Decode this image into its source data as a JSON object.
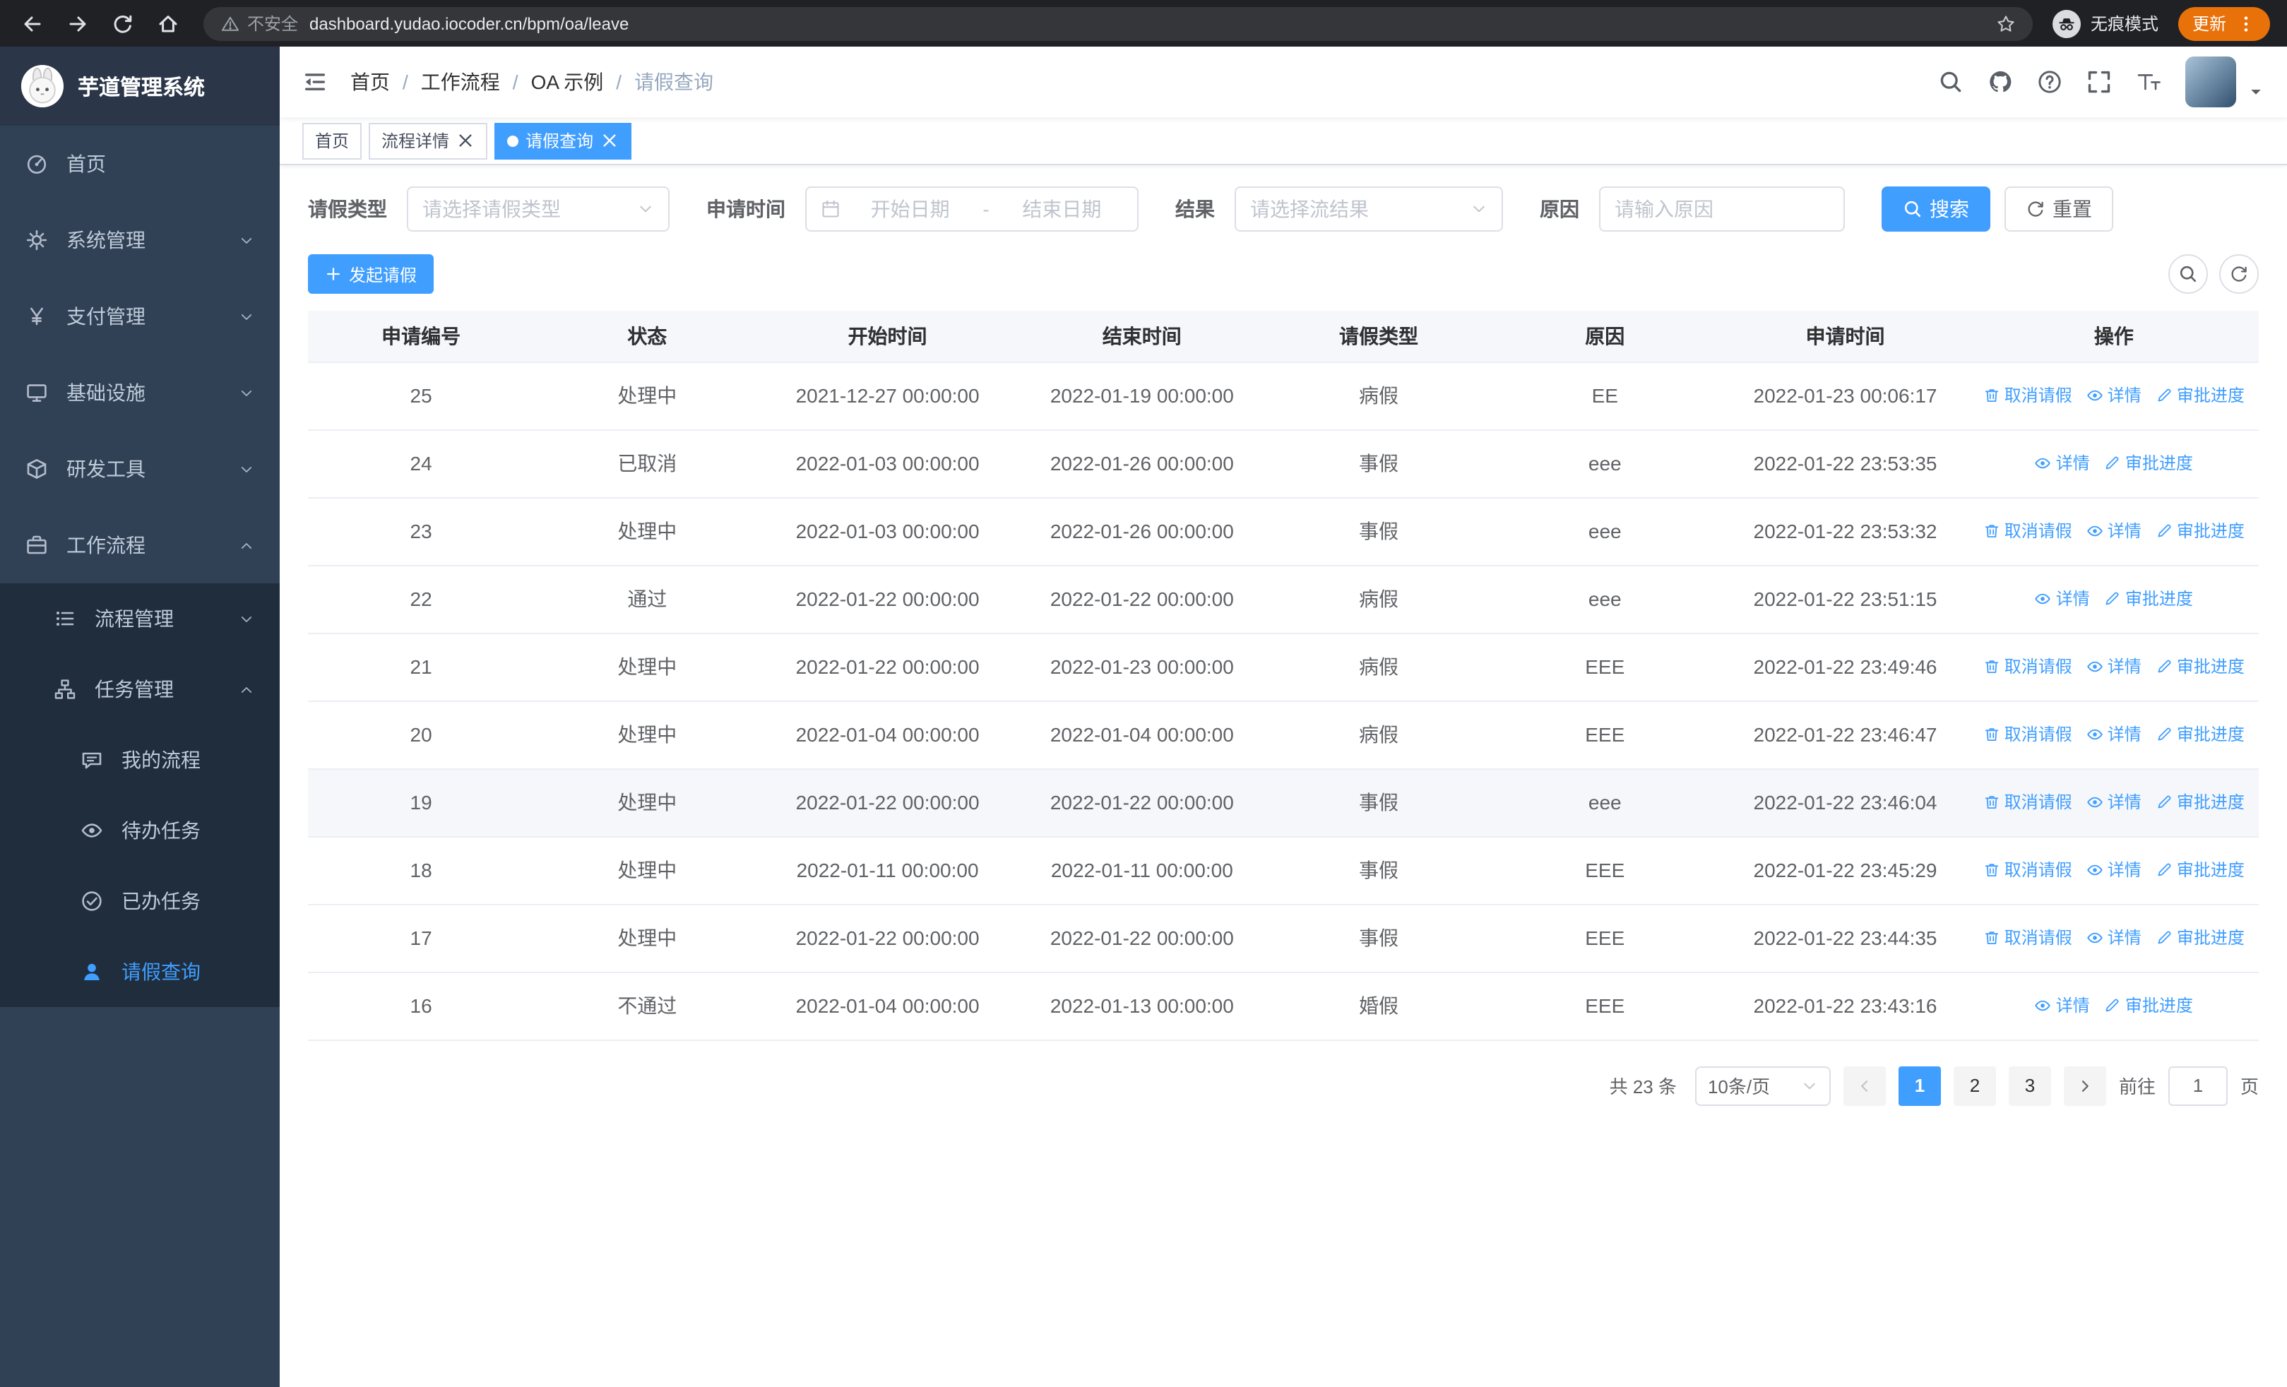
{
  "browser": {
    "security_label": "不安全",
    "url": "dashboard.yudao.iocoder.cn/bpm/oa/leave",
    "incognito_label": "无痕模式",
    "update_label": "更新"
  },
  "app": {
    "logo_title": "芋道管理系统"
  },
  "sidebar": {
    "items": [
      {
        "key": "home",
        "label": "首页",
        "icon": "dashboard-icon",
        "level": 0
      },
      {
        "key": "system",
        "label": "系统管理",
        "icon": "gear-icon",
        "level": 0,
        "chevron": "down"
      },
      {
        "key": "payment",
        "label": "支付管理",
        "icon": "yen-icon",
        "level": 0,
        "chevron": "down"
      },
      {
        "key": "infrastructure",
        "label": "基础设施",
        "icon": "monitor-icon",
        "level": 0,
        "chevron": "down"
      },
      {
        "key": "devtools",
        "label": "研发工具",
        "icon": "cube-icon",
        "level": 0,
        "chevron": "down"
      },
      {
        "key": "workflow",
        "label": "工作流程",
        "icon": "briefcase-icon",
        "level": 0,
        "chevron": "up"
      },
      {
        "key": "process-management",
        "label": "流程管理",
        "icon": "list-icon",
        "level": 1,
        "sub": true,
        "chevron": "down"
      },
      {
        "key": "task-management",
        "label": "任务管理",
        "icon": "tree-icon",
        "level": 1,
        "sub": true,
        "chevron": "up"
      },
      {
        "key": "my-process",
        "label": "我的流程",
        "icon": "message-icon",
        "level": 2,
        "sub": true
      },
      {
        "key": "todo-task",
        "label": "待办任务",
        "icon": "eye-icon",
        "level": 2,
        "sub": true
      },
      {
        "key": "done-task",
        "label": "已办任务",
        "icon": "done-icon",
        "level": 2,
        "sub": true
      },
      {
        "key": "leave-query",
        "label": "请假查询",
        "icon": "user-icon",
        "level": 2,
        "sub": true,
        "active": true
      }
    ]
  },
  "breadcrumb": {
    "items": [
      "首页",
      "工作流程",
      "OA 示例",
      "请假查询"
    ]
  },
  "tabs": [
    {
      "label": "首页",
      "closable": false,
      "active": false
    },
    {
      "label": "流程详情",
      "closable": true,
      "active": false
    },
    {
      "label": "请假查询",
      "closable": true,
      "active": true
    }
  ],
  "filters": {
    "leave_type": {
      "label": "请假类型",
      "placeholder": "请选择请假类型"
    },
    "apply_time": {
      "label": "申请时间",
      "start_placeholder": "开始日期",
      "separator": "-",
      "end_placeholder": "结束日期"
    },
    "result": {
      "label": "结果",
      "placeholder": "请选择流结果"
    },
    "reason": {
      "label": "原因",
      "placeholder": "请输入原因"
    },
    "search_label": "搜索",
    "reset_label": "重置"
  },
  "toolbar": {
    "create_label": "发起请假"
  },
  "table": {
    "headers": [
      "申请编号",
      "状态",
      "开始时间",
      "结束时间",
      "请假类型",
      "原因",
      "申请时间",
      "操作"
    ],
    "action_labels": {
      "cancel": "取消请假",
      "detail": "详情",
      "progress": "审批进度"
    },
    "rows": [
      {
        "id": "25",
        "status": "处理中",
        "start": "2021-12-27 00:00:00",
        "end": "2022-01-19 00:00:00",
        "type": "病假",
        "reason": "EE",
        "apply": "2022-01-23 00:06:17",
        "actions": [
          "cancel",
          "detail",
          "progress"
        ]
      },
      {
        "id": "24",
        "status": "已取消",
        "start": "2022-01-03 00:00:00",
        "end": "2022-01-26 00:00:00",
        "type": "事假",
        "reason": "eee",
        "apply": "2022-01-22 23:53:35",
        "actions": [
          "detail",
          "progress"
        ]
      },
      {
        "id": "23",
        "status": "处理中",
        "start": "2022-01-03 00:00:00",
        "end": "2022-01-26 00:00:00",
        "type": "事假",
        "reason": "eee",
        "apply": "2022-01-22 23:53:32",
        "actions": [
          "cancel",
          "detail",
          "progress"
        ]
      },
      {
        "id": "22",
        "status": "通过",
        "start": "2022-01-22 00:00:00",
        "end": "2022-01-22 00:00:00",
        "type": "病假",
        "reason": "eee",
        "apply": "2022-01-22 23:51:15",
        "actions": [
          "detail",
          "progress"
        ]
      },
      {
        "id": "21",
        "status": "处理中",
        "start": "2022-01-22 00:00:00",
        "end": "2022-01-23 00:00:00",
        "type": "病假",
        "reason": "EEE",
        "apply": "2022-01-22 23:49:46",
        "actions": [
          "cancel",
          "detail",
          "progress"
        ]
      },
      {
        "id": "20",
        "status": "处理中",
        "start": "2022-01-04 00:00:00",
        "end": "2022-01-04 00:00:00",
        "type": "病假",
        "reason": "EEE",
        "apply": "2022-01-22 23:46:47",
        "actions": [
          "cancel",
          "detail",
          "progress"
        ]
      },
      {
        "id": "19",
        "status": "处理中",
        "start": "2022-01-22 00:00:00",
        "end": "2022-01-22 00:00:00",
        "type": "事假",
        "reason": "eee",
        "apply": "2022-01-22 23:46:04",
        "actions": [
          "cancel",
          "detail",
          "progress"
        ],
        "highlighted": true
      },
      {
        "id": "18",
        "status": "处理中",
        "start": "2022-01-11 00:00:00",
        "end": "2022-01-11 00:00:00",
        "type": "事假",
        "reason": "EEE",
        "apply": "2022-01-22 23:45:29",
        "actions": [
          "cancel",
          "detail",
          "progress"
        ]
      },
      {
        "id": "17",
        "status": "处理中",
        "start": "2022-01-22 00:00:00",
        "end": "2022-01-22 00:00:00",
        "type": "事假",
        "reason": "EEE",
        "apply": "2022-01-22 23:44:35",
        "actions": [
          "cancel",
          "detail",
          "progress"
        ]
      },
      {
        "id": "16",
        "status": "不通过",
        "start": "2022-01-04 00:00:00",
        "end": "2022-01-13 00:00:00",
        "type": "婚假",
        "reason": "EEE",
        "apply": "2022-01-22 23:43:16",
        "actions": [
          "detail",
          "progress"
        ]
      }
    ]
  },
  "pagination": {
    "total_label": "共 23 条",
    "page_size": "10条/页",
    "pages": [
      "1",
      "2",
      "3"
    ],
    "active_page": "1",
    "goto_label": "前往",
    "goto_value": "1",
    "goto_suffix": "页"
  },
  "theme": {
    "primary": "#409eff",
    "sidebar_bg": "#304156",
    "sidebar_submenu_bg": "#1f2d3d",
    "active_text": "#409eff",
    "update_badge": "#e8710a",
    "table_border": "#ebeef5"
  }
}
